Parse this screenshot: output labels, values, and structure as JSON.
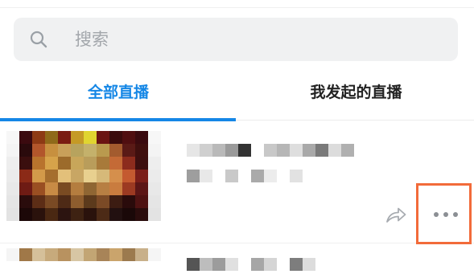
{
  "search": {
    "placeholder": "搜索",
    "icon": "search-icon"
  },
  "tabs": [
    {
      "label": "全部直播",
      "active": true
    },
    {
      "label": "我发起的直播",
      "active": false
    }
  ],
  "colors": {
    "accent": "#1587e6",
    "highlight_border": "#f26b3a"
  },
  "list": {
    "items": [
      {
        "title": "",
        "actions": [
          "share-icon",
          "more-icon"
        ]
      },
      {
        "title": ""
      }
    ]
  }
}
